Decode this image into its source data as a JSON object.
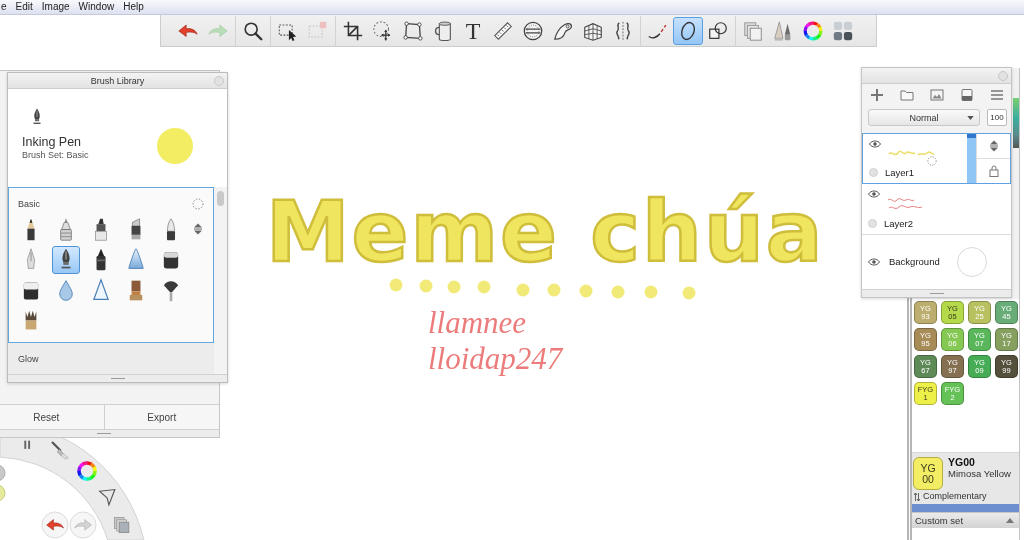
{
  "menu_bar": {
    "items": [
      "e",
      "Edit",
      "Image",
      "Window",
      "Help"
    ]
  },
  "toolbar": {
    "tools": [
      {
        "selected": false,
        "disabled": false
      },
      {
        "selected": false,
        "disabled": true
      },
      {
        "selected": false,
        "disabled": false
      },
      {
        "selected": false,
        "disabled": false
      },
      {
        "selected": false,
        "disabled": true
      },
      {
        "selected": false,
        "disabled": false
      },
      {
        "selected": false,
        "disabled": false
      },
      {
        "selected": false,
        "disabled": false
      },
      {
        "selected": false,
        "disabled": false
      },
      {
        "label": "T",
        "selected": false,
        "disabled": false
      },
      {
        "selected": false,
        "disabled": false
      },
      {
        "selected": false,
        "disabled": false
      },
      {
        "selected": false,
        "disabled": false
      },
      {
        "selected": false,
        "disabled": false
      },
      {
        "selected": false,
        "disabled": false
      },
      {
        "selected": false,
        "disabled": false
      },
      {
        "selected": true,
        "disabled": false
      },
      {
        "selected": false,
        "disabled": false
      },
      {
        "selected": false,
        "disabled": false
      },
      {
        "selected": false,
        "disabled": false
      },
      {
        "selected": false,
        "disabled": false
      },
      {
        "selected": false,
        "disabled": false
      }
    ]
  },
  "brush_panel": {
    "buttons": [
      "Reset",
      "Export"
    ]
  },
  "brush_library": {
    "title": "Brush Library",
    "brush_name": "Inking Pen",
    "brush_set": "Brush Set: Basic",
    "sets": [
      {
        "name": "Basic",
        "selected": true,
        "brushes": [
          {
            "selected": false
          },
          {
            "selected": false
          },
          {
            "selected": false
          },
          {
            "selected": false
          },
          {
            "selected": false
          },
          {
            "selected": false
          },
          {
            "selected": true
          },
          {
            "selected": false
          },
          {
            "selected": false
          },
          {
            "selected": false
          },
          {
            "selected": false
          },
          {
            "selected": false
          },
          {
            "selected": false
          },
          {
            "selected": false
          },
          {
            "selected": false
          },
          {
            "selected": false
          }
        ]
      },
      {
        "name": "Glow",
        "selected": false
      }
    ]
  },
  "canvas": {
    "lettering": "Meme chúa",
    "signature": [
      "llamnee",
      "lloidap247"
    ]
  },
  "layers_panel": {
    "blend_mode": "Normal",
    "opacity": "100",
    "layers": [
      {
        "kind": "paint",
        "name": "Layer1",
        "selected": true,
        "visible": true
      },
      {
        "kind": "paint",
        "name": "Layer2",
        "selected": false,
        "visible": true
      },
      {
        "kind": "background",
        "name": "Background",
        "selected": false,
        "visible": true
      }
    ]
  },
  "color_library": {
    "swatches": [
      {
        "label": "YG 93",
        "color": "#bcae6e"
      },
      {
        "label": "YG 05",
        "color": "#b4d94a"
      },
      {
        "label": "YG 25",
        "color": "#b8c060"
      },
      {
        "label": "YG 45",
        "color": "#68ac78"
      },
      {
        "label": "YG 95",
        "color": "#a88c58"
      },
      {
        "label": "YG 06",
        "color": "#86c854"
      },
      {
        "label": "YG 07",
        "color": "#5ab65a"
      },
      {
        "label": "YG 17",
        "color": "#86a060"
      },
      {
        "label": "YG 67",
        "color": "#5e8a58"
      },
      {
        "label": "YG 97",
        "color": "#857052"
      },
      {
        "label": "YG 09",
        "color": "#46ac56"
      },
      {
        "label": "YG 99",
        "color": "#55503c"
      },
      {
        "label": "FYG 1",
        "color": "#eef04a"
      },
      {
        "label": "FYG 2",
        "color": "#64c256"
      }
    ],
    "current": {
      "label": "YG 00",
      "code": "YG00",
      "name": "Mimosa Yellow",
      "color": "#f3ed64"
    },
    "complementary": "Complementary",
    "custom_set": "Custom set"
  },
  "radial_menu": {
    "buttons": [
      {
        "disabled": false
      },
      {
        "disabled": true
      }
    ]
  }
}
